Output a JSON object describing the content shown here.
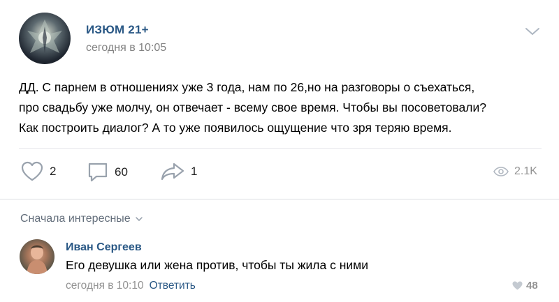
{
  "post": {
    "author": "ИЗЮМ 21+",
    "time": "сегодня в 10:05",
    "text_lines": [
      "ДД. С парнем в отношениях уже 3 года, нам по 26,но на разговоры о съехаться,",
      "про свадьбу уже молчу, он отвечает - всему свое время. Чтобы вы посоветовали?",
      "Как построить диалог? А то уже появилось ощущение что зря теряю время."
    ],
    "likes": "2",
    "comments": "60",
    "shares": "1",
    "views": "2.1K"
  },
  "comments_section": {
    "sort_label": "Сначала интересные",
    "items": [
      {
        "author": "Иван Сергеев",
        "text": "Его девушка или жена против, чтобы ты жила с ними",
        "time": "сегодня в 10:10",
        "reply_label": "Ответить",
        "likes": "48"
      }
    ]
  },
  "colors": {
    "link": "#2a5885",
    "muted": "#939393",
    "icon": "#99a2ad"
  },
  "icons": [
    "chevron-down-icon",
    "heart-icon",
    "comment-icon",
    "share-icon",
    "eye-icon",
    "small-chevron-icon",
    "small-heart-icon"
  ]
}
